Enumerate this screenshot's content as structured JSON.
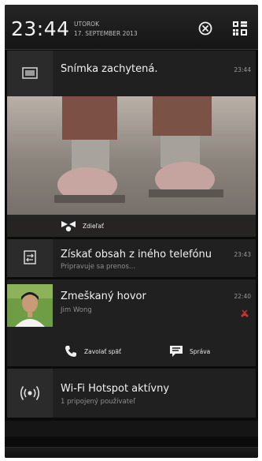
{
  "status_bar": {
    "time": "23:44",
    "day": "UTOROK",
    "date": "17. SEPTEMBER 2013"
  },
  "notifications": [
    {
      "title": "Snímka zachytená.",
      "time": "23:44",
      "action_label": "Zdieľať",
      "icon": "screenshot-icon"
    },
    {
      "title": "Získať obsah z iného telefónu",
      "subtitle": "Pripravuje sa prenos...",
      "time": "23:43",
      "icon": "transfer-icon"
    },
    {
      "title": "Zmeškaný hovor",
      "subtitle": "Jim Wong",
      "time": "22:40",
      "actions": [
        "Zavolať späť",
        "Správa"
      ],
      "icon": "missed-call-icon"
    },
    {
      "title": "Wi-Fi Hotspot aktívny",
      "subtitle": "1 pripojený používateľ",
      "icon": "hotspot-icon"
    }
  ],
  "colors": {
    "background": "#0b0b0b",
    "card": "#202020",
    "missed_call": "#d32f2f"
  }
}
